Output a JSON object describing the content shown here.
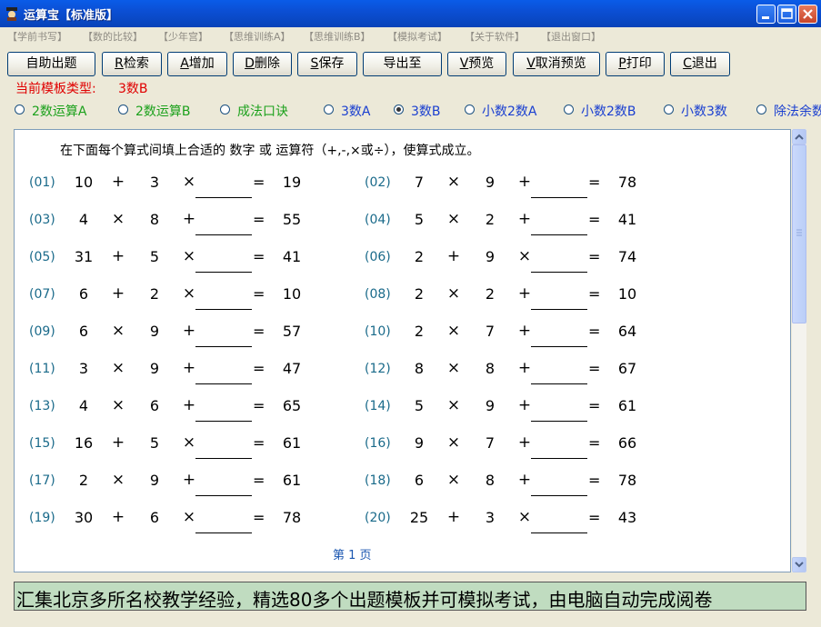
{
  "window": {
    "title": "运算宝【标准版】",
    "controls": [
      "minimize",
      "maximize",
      "close"
    ]
  },
  "menu": [
    "【学前书写】",
    "【数的比较】",
    "【少年宫】",
    "【思维训练A】",
    "【思维训练B】",
    "【模拟考试】",
    "【关于软件】",
    "【退出窗口】"
  ],
  "toolbar": {
    "auto_label": "自助出题",
    "search_key": "R",
    "search_label": "检索",
    "add_key": "A",
    "add_label": "增加",
    "delete_key": "D",
    "delete_label": "删除",
    "save_key": "S",
    "save_label": "保存",
    "export_label": "导出至",
    "preview_key": "V",
    "preview_label": "预览",
    "cancel_preview_key": "V",
    "cancel_preview_label": "取消预览",
    "print_key": "P",
    "print_label": "打印",
    "exit_key": "C",
    "exit_label": "退出"
  },
  "template": {
    "label": "当前模板类型:",
    "value": "3数B"
  },
  "template_options": [
    {
      "label": "2数运算A",
      "selected": false,
      "color": "#1ca11c"
    },
    {
      "label": "2数运算B",
      "selected": false,
      "color": "#1ca11c"
    },
    {
      "label": "成法口诀",
      "selected": false,
      "color": "#1ca11c"
    },
    {
      "label": "3数A",
      "selected": false,
      "color": "#1a3fd0"
    },
    {
      "label": "3数B",
      "selected": true,
      "color": "#1a3fd0"
    },
    {
      "label": "小数2数A",
      "selected": false,
      "color": "#1a3fd0"
    },
    {
      "label": "小数2数B",
      "selected": false,
      "color": "#1a3fd0"
    },
    {
      "label": "小数3数",
      "selected": false,
      "color": "#1a3fd0"
    },
    {
      "label": "除法余数",
      "selected": false,
      "color": "#1a3fd0"
    }
  ],
  "worksheet": {
    "instruction": "在下面每个算式间填上合适的 数字 或 运算符（+,-,×或÷），使算式成立。",
    "page": "第 1 页",
    "problems": [
      {
        "no": "(01)",
        "a": "10",
        "op1": "+",
        "b": "3",
        "op2": "×",
        "eq": "=",
        "result": "19"
      },
      {
        "no": "(02)",
        "a": "7",
        "op1": "×",
        "b": "9",
        "op2": "+",
        "eq": "=",
        "result": "78"
      },
      {
        "no": "(03)",
        "a": "4",
        "op1": "×",
        "b": "8",
        "op2": "+",
        "eq": "=",
        "result": "55"
      },
      {
        "no": "(04)",
        "a": "5",
        "op1": "×",
        "b": "2",
        "op2": "+",
        "eq": "=",
        "result": "41"
      },
      {
        "no": "(05)",
        "a": "31",
        "op1": "+",
        "b": "5",
        "op2": "×",
        "eq": "=",
        "result": "41"
      },
      {
        "no": "(06)",
        "a": "2",
        "op1": "+",
        "b": "9",
        "op2": "×",
        "eq": "=",
        "result": "74"
      },
      {
        "no": "(07)",
        "a": "6",
        "op1": "+",
        "b": "2",
        "op2": "×",
        "eq": "=",
        "result": "10"
      },
      {
        "no": "(08)",
        "a": "2",
        "op1": "×",
        "b": "2",
        "op2": "+",
        "eq": "=",
        "result": "10"
      },
      {
        "no": "(09)",
        "a": "6",
        "op1": "×",
        "b": "9",
        "op2": "+",
        "eq": "=",
        "result": "57"
      },
      {
        "no": "(10)",
        "a": "2",
        "op1": "×",
        "b": "7",
        "op2": "+",
        "eq": "=",
        "result": "64"
      },
      {
        "no": "(11)",
        "a": "3",
        "op1": "×",
        "b": "9",
        "op2": "+",
        "eq": "=",
        "result": "47"
      },
      {
        "no": "(12)",
        "a": "8",
        "op1": "×",
        "b": "8",
        "op2": "+",
        "eq": "=",
        "result": "67"
      },
      {
        "no": "(13)",
        "a": "4",
        "op1": "×",
        "b": "6",
        "op2": "+",
        "eq": "=",
        "result": "65"
      },
      {
        "no": "(14)",
        "a": "5",
        "op1": "×",
        "b": "9",
        "op2": "+",
        "eq": "=",
        "result": "61"
      },
      {
        "no": "(15)",
        "a": "16",
        "op1": "+",
        "b": "5",
        "op2": "×",
        "eq": "=",
        "result": "61"
      },
      {
        "no": "(16)",
        "a": "9",
        "op1": "×",
        "b": "7",
        "op2": "+",
        "eq": "=",
        "result": "66"
      },
      {
        "no": "(17)",
        "a": "2",
        "op1": "×",
        "b": "9",
        "op2": "+",
        "eq": "=",
        "result": "61"
      },
      {
        "no": "(18)",
        "a": "6",
        "op1": "×",
        "b": "8",
        "op2": "+",
        "eq": "=",
        "result": "78"
      },
      {
        "no": "(19)",
        "a": "30",
        "op1": "+",
        "b": "6",
        "op2": "×",
        "eq": "=",
        "result": "78"
      },
      {
        "no": "(20)",
        "a": "25",
        "op1": "+",
        "b": "3",
        "op2": "×",
        "eq": "=",
        "result": "43"
      }
    ]
  },
  "status": {
    "text": "汇集北京多所名校教学经验，精选80多个出题模板并可模拟考试，由电脑自动完成阅卷"
  }
}
